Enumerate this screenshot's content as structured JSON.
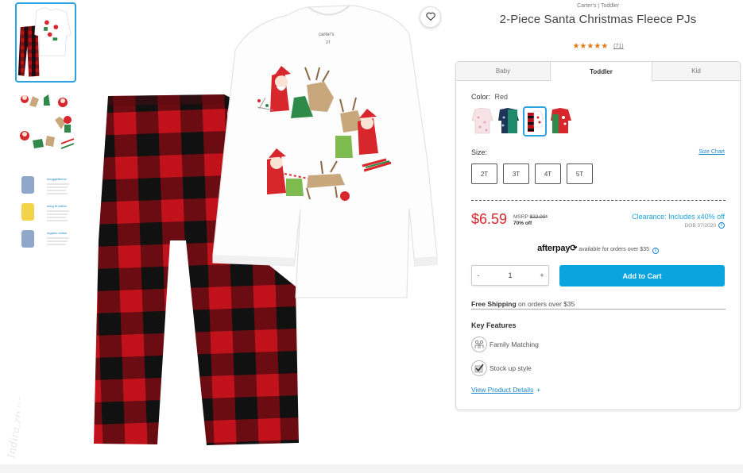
{
  "product": {
    "brand_line": "Carter's | Toddler",
    "title": "2-Piece Santa Christmas Fleece PJs",
    "rating_stars": "★★★★★",
    "review_count": "(71)"
  },
  "watermark": "Indira.zp.ua",
  "tabs": [
    {
      "label": "Baby",
      "selected": false
    },
    {
      "label": "Toddler",
      "selected": true
    },
    {
      "label": "Kid",
      "selected": false
    }
  ],
  "color": {
    "label": "Color:",
    "value": "Red",
    "swatches": [
      {
        "name": "pink-print",
        "selected": false,
        "colors": [
          "#f4d9de",
          "#e7a3b1"
        ]
      },
      {
        "name": "navy-green",
        "selected": false,
        "colors": [
          "#1f3558",
          "#1e8a6b"
        ]
      },
      {
        "name": "red-plaid",
        "selected": true,
        "colors": [
          "#ffffff",
          "#b5121b"
        ]
      },
      {
        "name": "green-red",
        "selected": false,
        "colors": [
          "#2f8a4a",
          "#d7262c"
        ]
      }
    ]
  },
  "size": {
    "label": "Size:",
    "chart_link": "Size Chart",
    "options": [
      "2T",
      "3T",
      "4T",
      "5T"
    ]
  },
  "pricing": {
    "price": "$6.59",
    "msrp_label": "MSRP",
    "msrp_value": "$22.00*",
    "percent_off": "70% off",
    "clearance": "Clearance: Includes x40% off",
    "dob": "DOB 07/2020",
    "info_glyph": "i"
  },
  "afterpay": {
    "logo": "afterpay",
    "logo_mark": "⟳",
    "text": "available for orders over $35"
  },
  "quantity": {
    "minus": "-",
    "value": "1",
    "plus": "+"
  },
  "add_to_cart": "Add to Cart",
  "shipping": {
    "bold": "Free Shipping",
    "rest": " on orders over $35"
  },
  "key_features": {
    "title": "Key Features",
    "items": [
      {
        "label": "Family Matching",
        "icon": "family-icon"
      },
      {
        "label": "Stock up style",
        "icon": "check-stack-icon"
      }
    ]
  },
  "view_details": {
    "label": "View Product Details",
    "plus": "+"
  },
  "garment_labels": {
    "neck_tag": "carter's",
    "neck_size": "3T"
  },
  "thumb_text": {
    "sections": [
      "snugglefleece",
      "snug fit cotton",
      "organic cotton"
    ]
  },
  "colors": {
    "accent_blue": "#0aa4df",
    "price_red": "#d9272e",
    "plaid_red": "#b5121b",
    "plaid_black": "#111111",
    "star_orange": "#e07b1a"
  }
}
